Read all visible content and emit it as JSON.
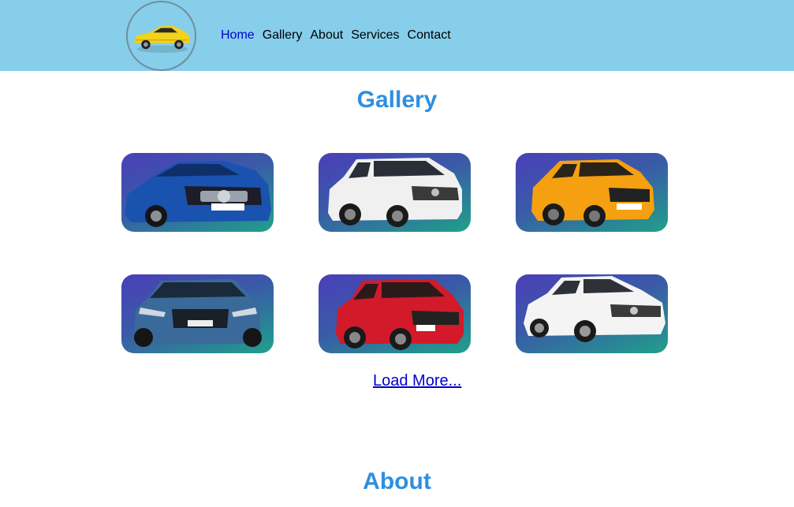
{
  "header": {
    "logo_icon": "yellow-sports-car-logo",
    "nav": [
      {
        "label": "Home",
        "active": true
      },
      {
        "label": "Gallery",
        "active": false
      },
      {
        "label": "About",
        "active": false
      },
      {
        "label": "Services",
        "active": false
      },
      {
        "label": "Contact",
        "active": false
      }
    ]
  },
  "gallery": {
    "title": "Gallery",
    "cards": [
      {
        "icon": "blue-convertible-car-icon",
        "color": "#1a52b0"
      },
      {
        "icon": "white-suv-car-icon",
        "color": "#f0f0f0"
      },
      {
        "icon": "orange-hatchback-car-icon",
        "color": "#f5a010"
      },
      {
        "icon": "blue-electric-suv-car-icon",
        "color": "#3a6a9a"
      },
      {
        "icon": "red-compact-suv-car-icon",
        "color": "#d21a2a"
      },
      {
        "icon": "white-sedan-car-icon",
        "color": "#f4f4f4"
      }
    ],
    "load_more": "Load More..."
  },
  "about": {
    "title": "About"
  },
  "colors": {
    "header_bg": "#87ceeb",
    "title": "#2e8fe0",
    "active_nav": "#0000cc",
    "card_gradient_top": "#4a3fb8",
    "card_gradient_bottom": "#20a08a"
  }
}
